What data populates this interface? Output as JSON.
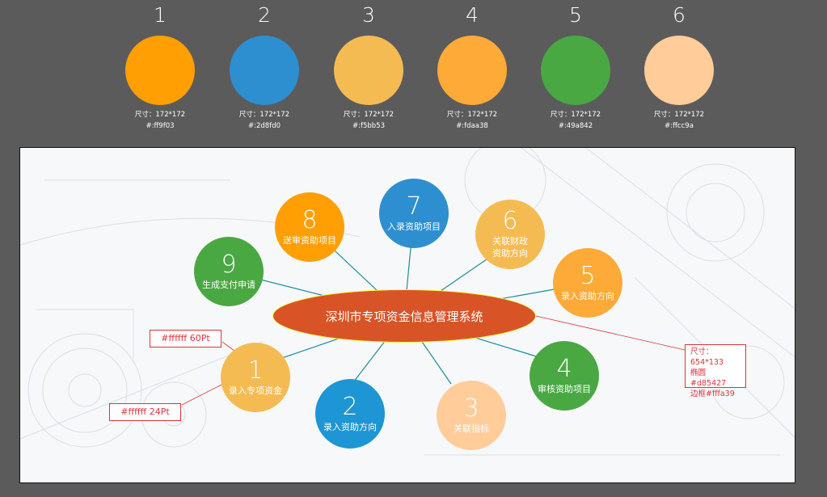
{
  "swatches": [
    {
      "number": "1",
      "size": "尺寸：172*172",
      "hex": "#:ff9f03",
      "color": "#ff9f03"
    },
    {
      "number": "2",
      "size": "尺寸：172*172",
      "hex": "#:2d8fd0",
      "color": "#2d8fd0"
    },
    {
      "number": "3",
      "size": "尺寸：172*172",
      "hex": "#:f5bb53",
      "color": "#f5bb53"
    },
    {
      "number": "4",
      "size": "尺寸：172*172",
      "hex": "#:fdaa38",
      "color": "#fdaa38"
    },
    {
      "number": "5",
      "size": "尺寸：172*172",
      "hex": "#:49a842",
      "color": "#49a842"
    },
    {
      "number": "6",
      "size": "尺寸：172*172",
      "hex": "#:ffcc9a",
      "color": "#ffcc9a"
    }
  ],
  "diagram": {
    "center_label": "深圳市专项资金信息管理系统",
    "center_color": "#d85427",
    "center_border": "#fffa39",
    "connector_color": "#1b8e9a",
    "nodes": [
      {
        "number": "1",
        "label": "录入专项资金",
        "color": "#f5bb53"
      },
      {
        "number": "2",
        "label": "录入资助方向",
        "color": "#1e95d4"
      },
      {
        "number": "3",
        "label": "关联指标",
        "color": "#ffcc9a"
      },
      {
        "number": "4",
        "label": "审核资助项目",
        "color": "#49a842"
      },
      {
        "number": "5",
        "label": "录入资助方向",
        "color": "#fdaa38"
      },
      {
        "number": "6",
        "label": "关联财政\n资助方向",
        "color": "#f5bb53"
      },
      {
        "number": "7",
        "label": "入录资助项目",
        "color": "#2d8fd0"
      },
      {
        "number": "8",
        "label": "送审资助项目",
        "color": "#ff9f03"
      },
      {
        "number": "9",
        "label": "生成支付申请",
        "color": "#49a842"
      }
    ]
  },
  "annotations": {
    "number_font": "#ffffff 60Pt",
    "label_font": "#ffffff 24Pt",
    "ellipse_spec": [
      "尺寸：654*133",
      "椭圆#d85427",
      "边框#fffa39"
    ],
    "color": "#e0313a"
  }
}
